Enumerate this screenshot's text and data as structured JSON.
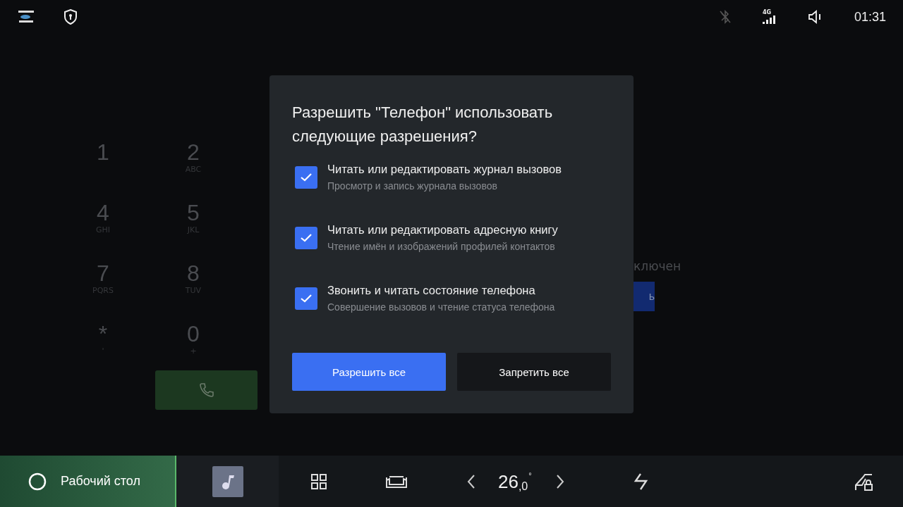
{
  "status_bar": {
    "time": "01:31",
    "network": "4G"
  },
  "dialpad": {
    "keys": [
      {
        "digit": "1"
      },
      {
        "digit": "2",
        "letters": "ABC"
      },
      {
        "digit": "4",
        "letters": "GHI"
      },
      {
        "digit": "5",
        "letters": "JKL"
      },
      {
        "digit": "7",
        "letters": "PQRS"
      },
      {
        "digit": "8",
        "letters": "TUV"
      },
      {
        "digit": "*",
        "letters": "'"
      },
      {
        "digit": "0",
        "letters": "+"
      }
    ]
  },
  "background_panel": {
    "status_text": "ключен",
    "button_label": "ь"
  },
  "dialog": {
    "title": "Разрешить \"Телефон\" использовать следующие разрешения?",
    "permissions": [
      {
        "title": "Читать или редактировать журнал вызовов",
        "description": "Просмотр и запись журнала вызовов",
        "checked": true
      },
      {
        "title": "Читать или редактировать адресную книгу",
        "description": "Чтение имён и изображений профилей контактов",
        "checked": true
      },
      {
        "title": "Звонить и читать состояние телефона",
        "description": "Совершение вызовов и чтение статуса телефона",
        "checked": true
      }
    ],
    "buttons": [
      {
        "label": "Разрешить все",
        "kind": "primary"
      },
      {
        "label": "Запретить все",
        "kind": "secondary"
      }
    ]
  },
  "dock": {
    "home_label": "Рабочий стол",
    "temperature_whole": "26",
    "temperature_fraction": ",0",
    "temperature_unit": "°"
  }
}
